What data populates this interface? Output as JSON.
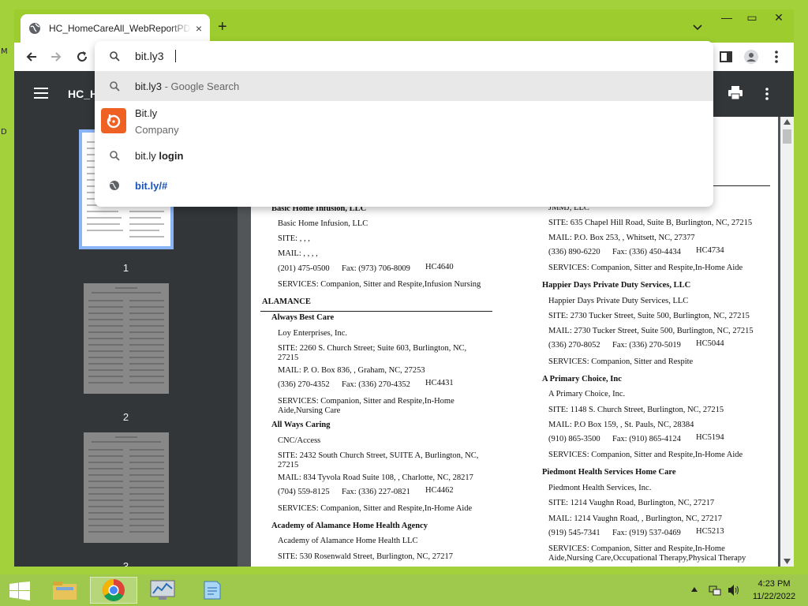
{
  "browser": {
    "tab_title": "HC_HomeCareAll_WebReportPDF",
    "tab_close": "×",
    "new_tab": "+",
    "win_minimize": "—",
    "win_restore": "▭",
    "win_close": "✕"
  },
  "omnibox": {
    "input_value": "bit.ly3",
    "suggestions": [
      {
        "text": "bit.ly3",
        "suffix": " - Google Search",
        "icon": "search-icon"
      },
      {
        "title": "Bit.ly",
        "subtitle": "Company",
        "icon": "bitly-logo"
      },
      {
        "text_plain": "bit.ly ",
        "text_bold": "login",
        "icon": "search-icon"
      },
      {
        "text": "bit.ly/#",
        "icon": "globe-icon"
      }
    ]
  },
  "pdf": {
    "title": "HC_H",
    "thumbs": [
      {
        "num": "1"
      },
      {
        "num": "2"
      },
      {
        "num": "3"
      }
    ]
  },
  "left_col": {
    "entries": [
      {
        "name": "Basic Home Infusion, LLC",
        "company": "Basic Home Infusion, LLC",
        "site": "SITE: , , ,",
        "mail": "MAIL: , , , ,",
        "phone": "(201) 475-0500",
        "fax": "Fax: (973) 706-8009",
        "id": "HC4640",
        "services": "SERVICES: Companion, Sitter and Respite,Infusion Nursing"
      }
    ],
    "county": "ALAMANCE",
    "entries2": [
      {
        "name": "Always Best Care",
        "company": "Loy Enterprises, Inc.",
        "site": "SITE: 2260 S. Church Street; Suite 603, Burlington, NC, 27215",
        "mail": "MAIL: P. O. Box 836, , Graham, NC, 27253",
        "phone": "(336) 270-4352",
        "fax": "Fax: (336) 270-4352",
        "id": "HC4431",
        "services": "SERVICES: Companion, Sitter and Respite,In-Home Aide,Nursing Care"
      },
      {
        "name": "All Ways Caring",
        "company": "CNC/Access",
        "site": "SITE: 2432 South Church Street, SUITE A, Burlington, NC, 27215",
        "mail": "MAIL: 834 Tyvola Road Suite 108, , Charlotte, NC, 28217",
        "phone": "(704) 559-8125",
        "fax": "Fax: (336) 227-0821",
        "id": "HC4462",
        "services": "SERVICES: Companion, Sitter and Respite,In-Home Aide"
      },
      {
        "name": "Academy of Alamance Home Health Agency",
        "company": "Academy of Alamance Home Health LLC",
        "site": "SITE: 530 Rosenwald Street, Burlington, NC, 27217"
      }
    ]
  },
  "right_col": {
    "top_company": "JMMJ, LLC",
    "top_site": "SITE: 635 Chapel Hill Road, Suite B, Burlington, NC, 27215",
    "top_mail": "MAIL: P.O. Box 253, , Whitsett, NC, 27377",
    "top_phone": "(336) 890-6220",
    "top_fax": "Fax: (336) 450-4434",
    "top_id": "HC4734",
    "top_services": "SERVICES: Companion, Sitter and Respite,In-Home Aide",
    "entries": [
      {
        "name": "Happier Days Private Duty Services, LLC",
        "company": "Happier Days Private Duty Services, LLC",
        "site": "SITE: 2730 Tucker Street, Suite 500, Burlington, NC, 27215",
        "mail": "MAIL: 2730 Tucker Street, Suite 500, Burlington, NC, 27215",
        "phone": "(336) 270-8052",
        "fax": "Fax: (336) 270-5019",
        "id": "HC5044",
        "services": "SERVICES: Companion, Sitter and Respite"
      },
      {
        "name": "A Primary Choice, Inc",
        "company": "A Primary Choice, Inc.",
        "site": "SITE: 1148 S. Church Street, Burlington, NC, 27215",
        "mail": "MAIL: P.O Box 159, , St. Pauls, NC, 28384",
        "phone": "(910) 865-3500",
        "fax": "Fax: (910) 865-4124",
        "id": "HC5194",
        "services": "SERVICES: Companion, Sitter and Respite,In-Home Aide"
      },
      {
        "name": "Piedmont Health Services Home Care",
        "company": "Piedmont Health Services, Inc.",
        "site": "SITE: 1214 Vaughn Road, Burlington, NC, 27217",
        "mail": "MAIL: 1214 Vaughn Road, , Burlington, NC, 27217",
        "phone": "(919) 545-7341",
        "fax": "Fax: (919) 537-0469",
        "id": "HC5213",
        "services": "SERVICES: Companion, Sitter and Respite,In-Home",
        "services2": "Aide,Nursing Care,Occupational Therapy,Physical Therapy"
      }
    ]
  },
  "desktop": {
    "label_m": "M",
    "label_d": "D"
  },
  "taskbar": {
    "time": "4:23 PM",
    "date": "11/22/2022"
  }
}
